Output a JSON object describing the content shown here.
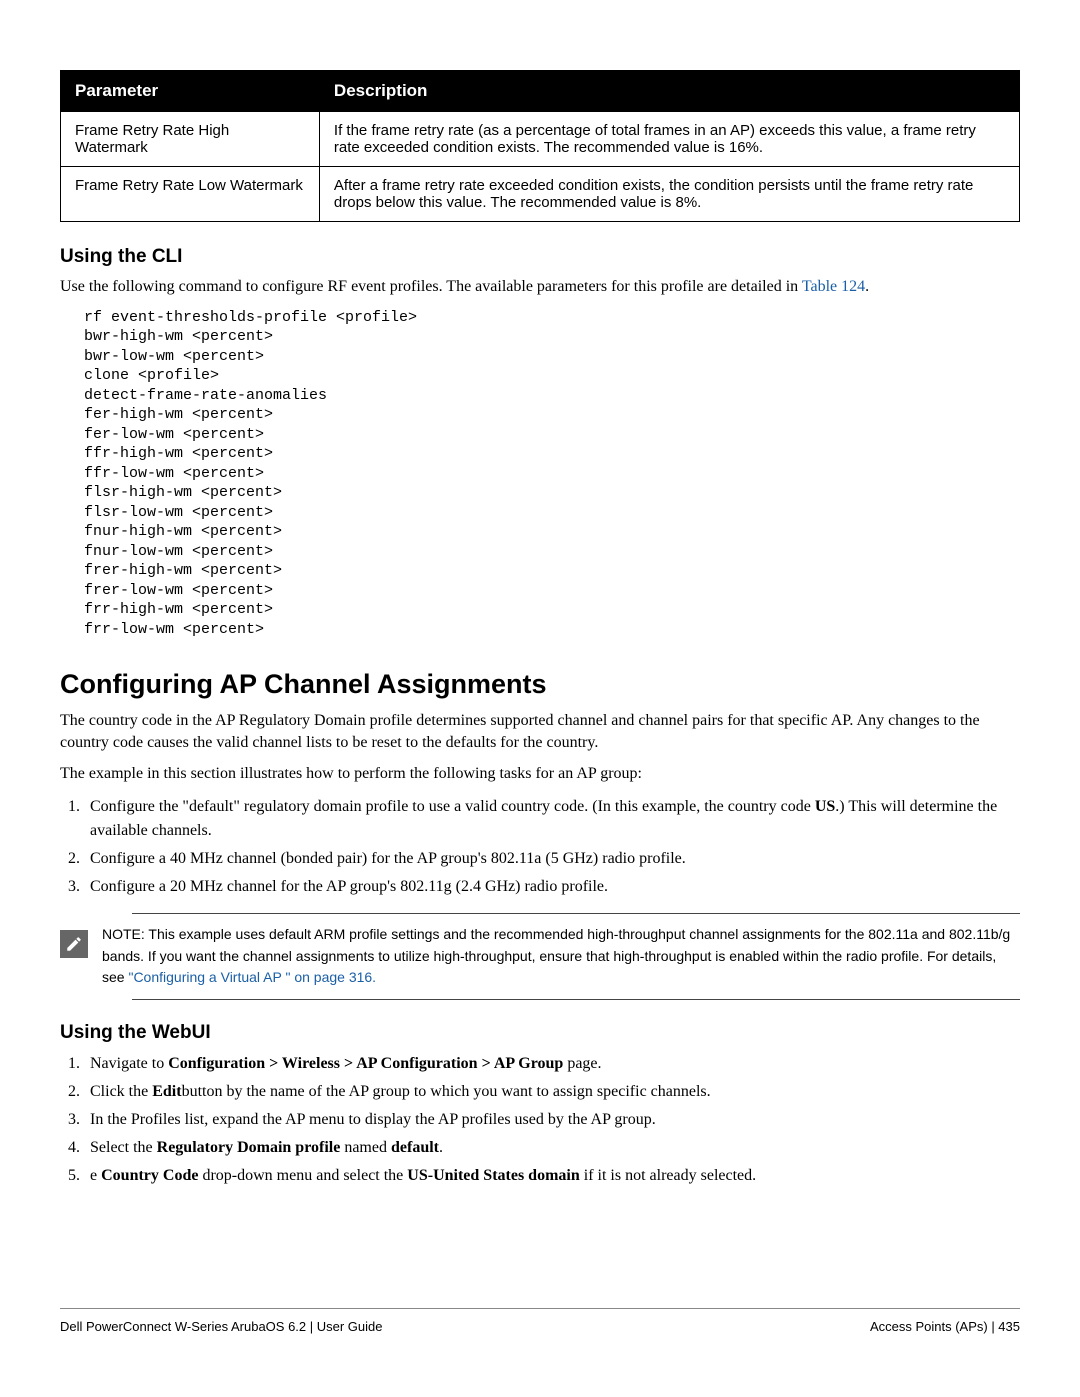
{
  "table": {
    "headers": {
      "param": "Parameter",
      "desc": "Description"
    },
    "rows": [
      {
        "param": "Frame Retry Rate High Watermark",
        "desc": "If the frame retry rate (as a percentage of total frames in an AP) exceeds this value, a frame retry rate exceeded condition exists. The recommended value is 16%."
      },
      {
        "param": "Frame Retry Rate Low Watermark",
        "desc": "After a frame retry rate exceeded condition exists, the condition persists until the frame retry rate drops below this value. The recommended value is 8%."
      }
    ]
  },
  "cli": {
    "heading": "Using the CLI",
    "intro_pre": "Use the following command to configure RF event profiles. The available parameters for this profile are detailed in ",
    "intro_link": "Table 124",
    "intro_post": ".",
    "code": "rf event-thresholds-profile <profile>\nbwr-high-wm <percent>\nbwr-low-wm <percent>\nclone <profile>\ndetect-frame-rate-anomalies\nfer-high-wm <percent>\nfer-low-wm <percent>\nffr-high-wm <percent>\nffr-low-wm <percent>\nflsr-high-wm <percent>\nflsr-low-wm <percent>\nfnur-high-wm <percent>\nfnur-low-wm <percent>\nfrer-high-wm <percent>\nfrer-low-wm <percent>\nfrr-high-wm <percent>\nfrr-low-wm <percent>"
  },
  "section": {
    "title": "Configuring AP Channel Assignments",
    "p1": "The country code in the AP Regulatory Domain profile determines supported channel and channel pairs for that specific AP. Any changes to the country code causes the valid channel lists to be reset to the defaults for the country.",
    "p2": "The example in this section illustrates how to perform the following tasks for an AP group:",
    "steps": {
      "s1a": "Configure the \"default\" regulatory domain profile to use a valid country code. (In this example, the country code ",
      "s1b": "US",
      "s1c": ".) This will determine the available channels.",
      "s2": "Configure a 40 MHz channel (bonded pair) for the AP group's 802.11a (5 GHz) radio profile.",
      "s3": "Configure a 20 MHz channel for the AP group's 802.11g (2.4 GHz) radio profile."
    }
  },
  "note": {
    "text_pre": "NOTE: This example uses default ARM profile settings and the recommended high-throughput channel assignments for the 802.11a and 802.11b/g bands. If you want the channel assignments to utilize high-throughput, ensure that high-throughput is enabled within the radio profile. For details, see ",
    "link": "\"Configuring a Virtual AP \" on page 316."
  },
  "webui": {
    "heading": "Using the WebUI",
    "steps": {
      "s1a": "Navigate to ",
      "s1b": "Configuration > Wireless > AP Configuration > AP Group",
      "s1c": " page.",
      "s2a": "Click the ",
      "s2b": "Edit",
      "s2c": "button by the name of the AP group to which you want to assign specific channels.",
      "s3": "In the Profiles list, expand the AP menu to display the AP profiles used by the AP group.",
      "s4a": "Select the ",
      "s4b": "Regulatory Domain profile",
      "s4c": " named ",
      "s4d": "default",
      "s4e": ".",
      "s5a": "e ",
      "s5b": "Country Code",
      "s5c": " drop-down menu and select the ",
      "s5d": "US-United States domain",
      "s5e": " if it is not already selected."
    }
  },
  "footer": {
    "left": "Dell PowerConnect W-Series ArubaOS 6.2  |  User Guide",
    "right": "Access Points (APs)  |  435"
  }
}
